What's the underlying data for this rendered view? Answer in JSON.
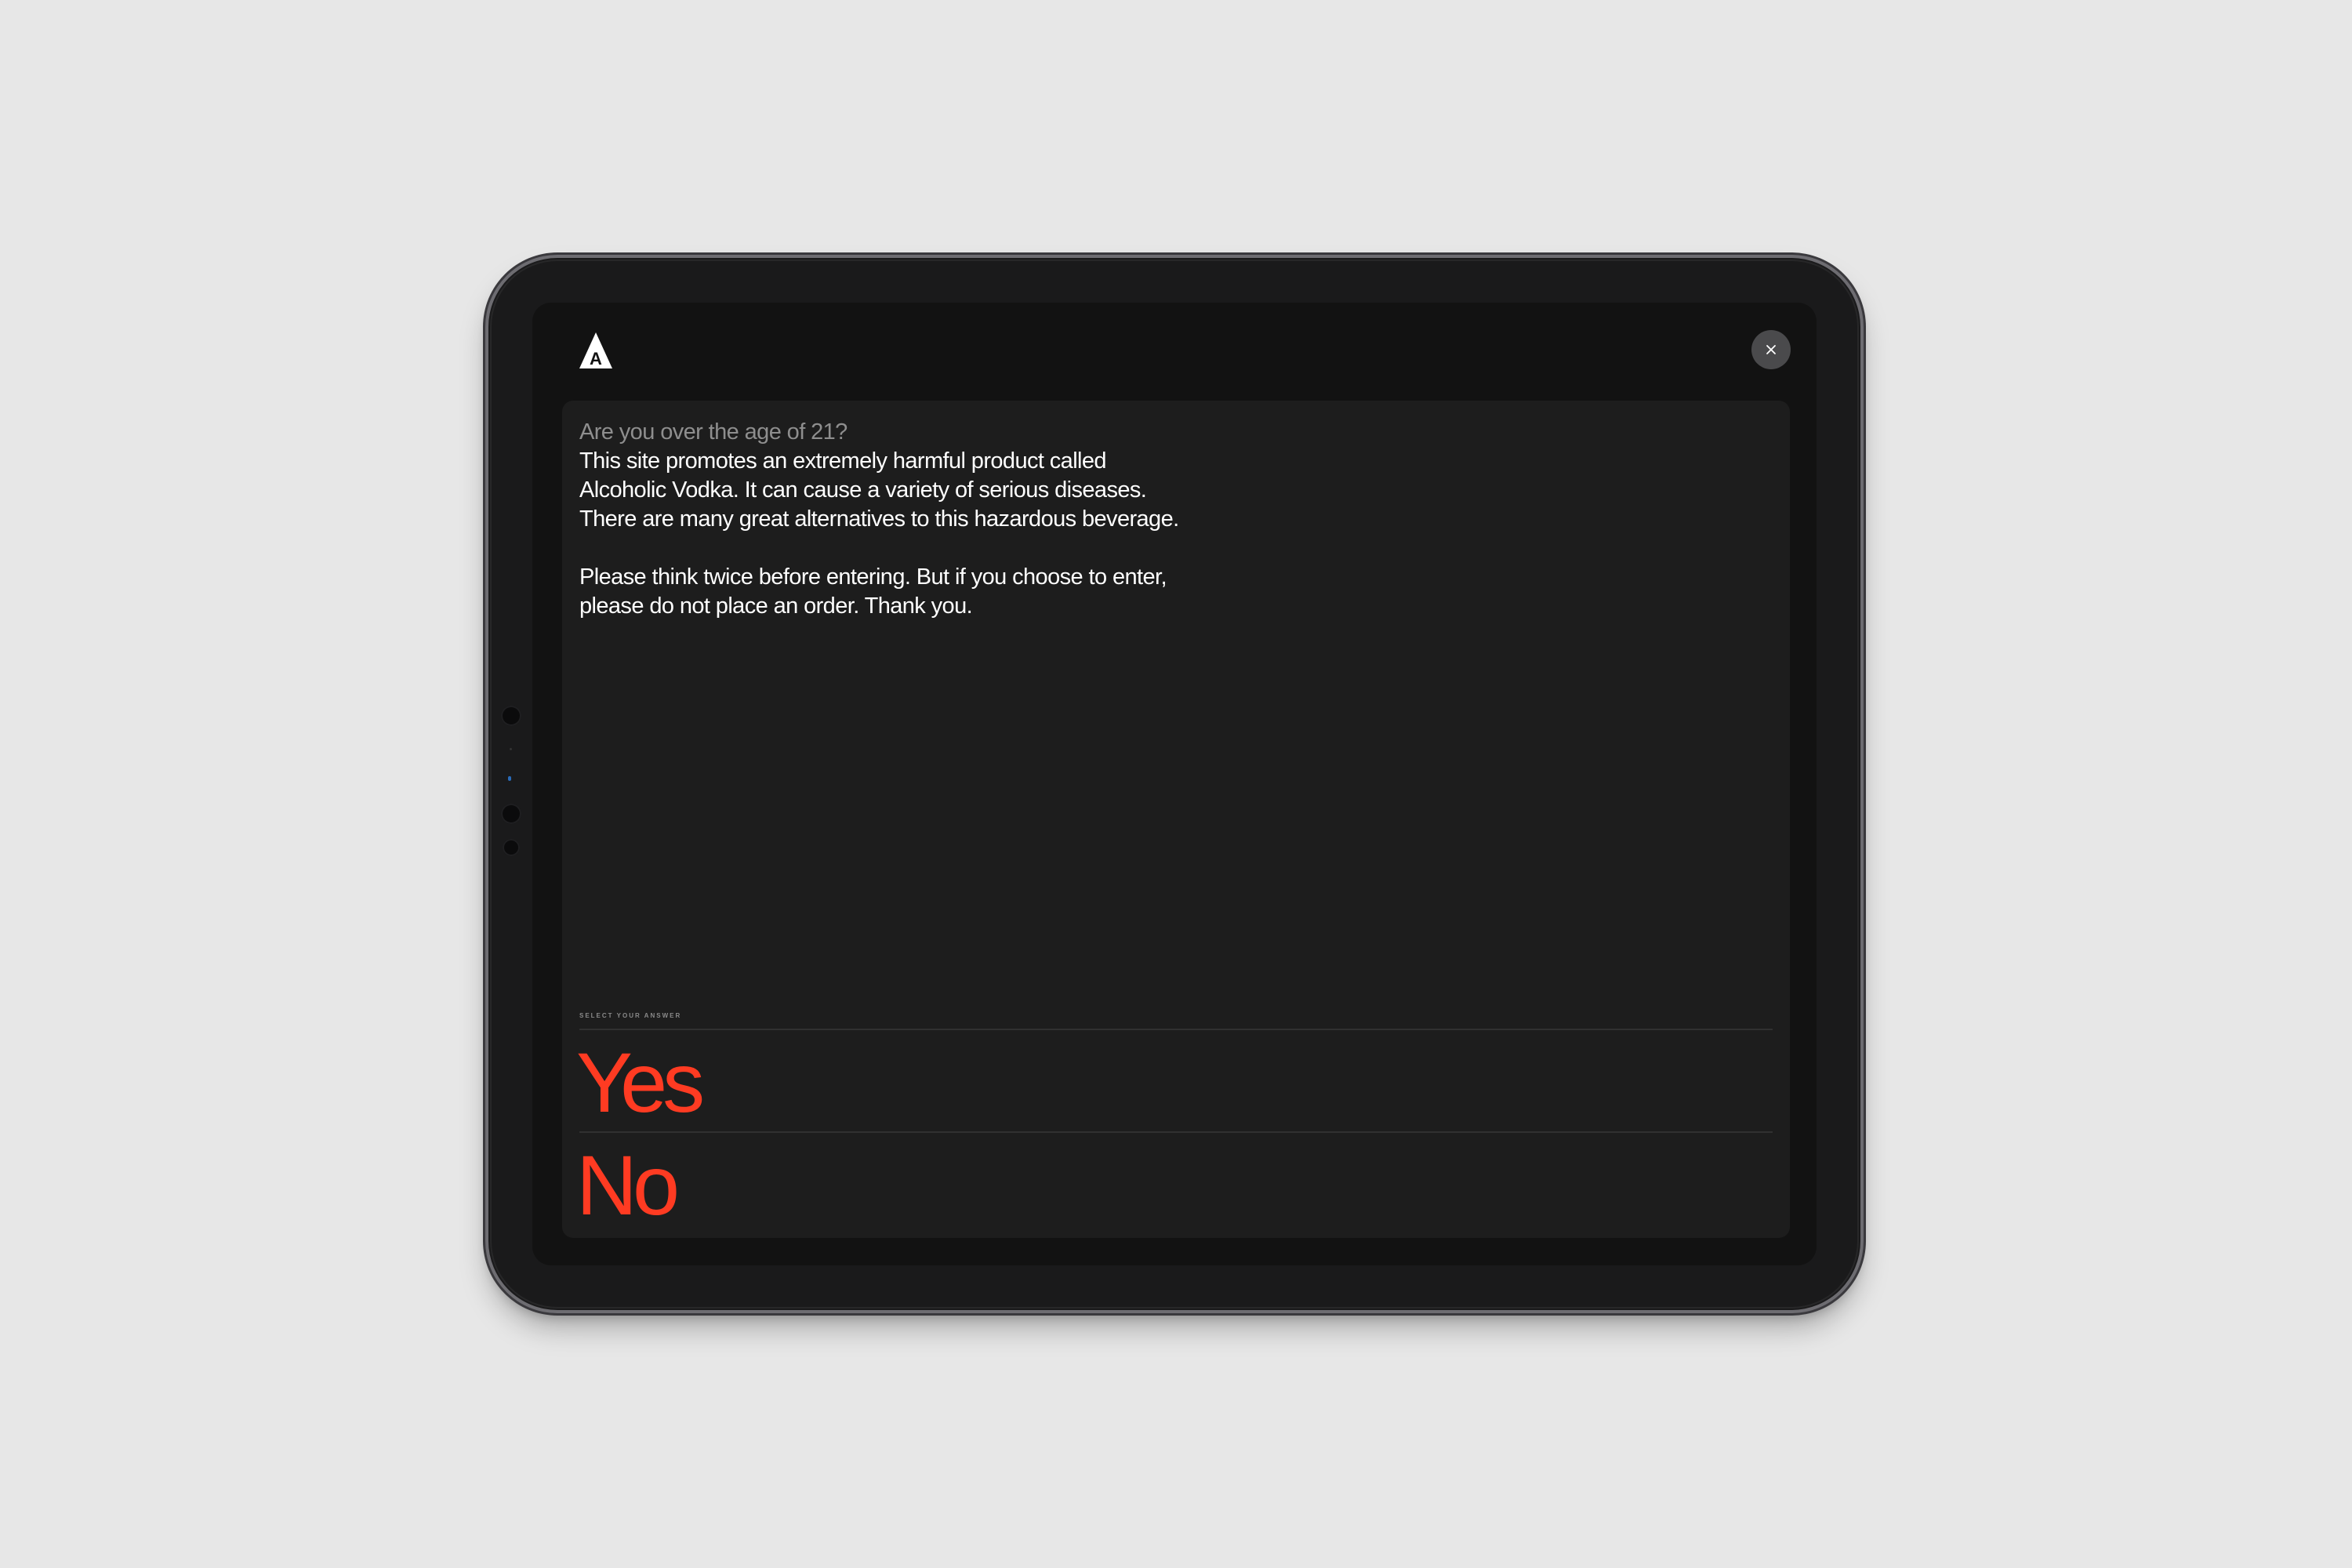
{
  "modal": {
    "question": "Are you over the age of 21?",
    "body_lines": [
      "This site promotes an extremely harmful product called",
      "Alcoholic Vodka. It can cause a variety of serious diseases.",
      "There are many great alternatives to this hazardous beverage."
    ],
    "body_lines_2": [
      "Please think twice before entering. But if you choose to enter,",
      "please do not place an order. Thank you."
    ],
    "answer_prompt": "SELECT YOUR ANSWER",
    "answers": {
      "yes": "Yes",
      "no": "No"
    },
    "logo_letter": "A"
  },
  "icons": {
    "logo": "triangle-a-logo-icon",
    "close": "close-icon"
  },
  "colors": {
    "page_background": "#e7e7e7",
    "screen_background": "#121212",
    "panel_background": "#1d1d1d",
    "accent": "#ff3b22",
    "text_primary": "#ffffff",
    "text_muted": "#8e8e8e"
  }
}
